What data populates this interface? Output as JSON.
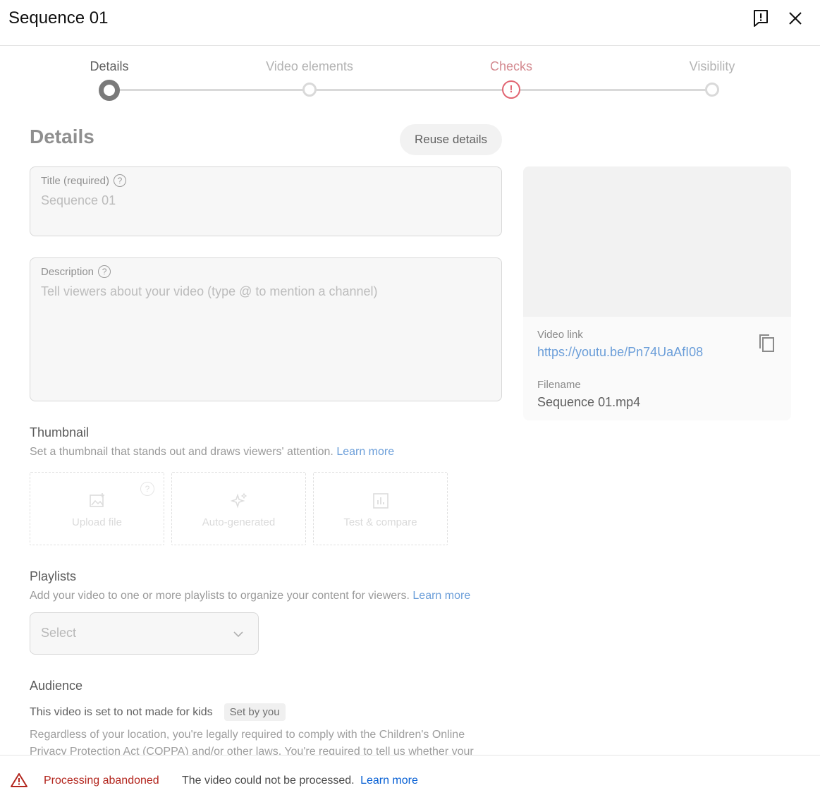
{
  "dialog": {
    "title": "Sequence 01"
  },
  "steps": [
    {
      "label": "Details",
      "state": "active"
    },
    {
      "label": "Video elements",
      "state": "pending"
    },
    {
      "label": "Checks",
      "state": "error"
    },
    {
      "label": "Visibility",
      "state": "pending"
    }
  ],
  "details": {
    "heading": "Details",
    "reuse_label": "Reuse details",
    "title_label": "Title (required)",
    "title_value": "Sequence 01",
    "description_label": "Description",
    "description_placeholder": "Tell viewers about your video (type @ to mention a channel)"
  },
  "preview": {
    "video_link_label": "Video link",
    "video_link": "https://youtu.be/Pn74UaAfI08",
    "filename_label": "Filename",
    "filename": "Sequence 01.mp4"
  },
  "thumbnail": {
    "heading": "Thumbnail",
    "description": "Set a thumbnail that stands out and draws viewers' attention.",
    "learn_more": "Learn more",
    "options": [
      "Upload file",
      "Auto-generated",
      "Test & compare"
    ]
  },
  "playlists": {
    "heading": "Playlists",
    "description": "Add your video to one or more playlists to organize your content for viewers.",
    "learn_more": "Learn more",
    "select_value": "Select"
  },
  "audience": {
    "heading": "Audience",
    "status": "This video is set to not made for kids",
    "badge": "Set by you",
    "legal": "Regardless of your location, you're legally required to comply with the Children's Online Privacy Protection Act (COPPA) and/or other laws. You're required to tell us whether your"
  },
  "footer": {
    "status": "Processing abandoned",
    "message": "The video could not be processed.",
    "learn_more": "Learn more"
  },
  "colors": {
    "error": "#b3261e",
    "link": "#065fd4",
    "step_error": "#e16572"
  }
}
